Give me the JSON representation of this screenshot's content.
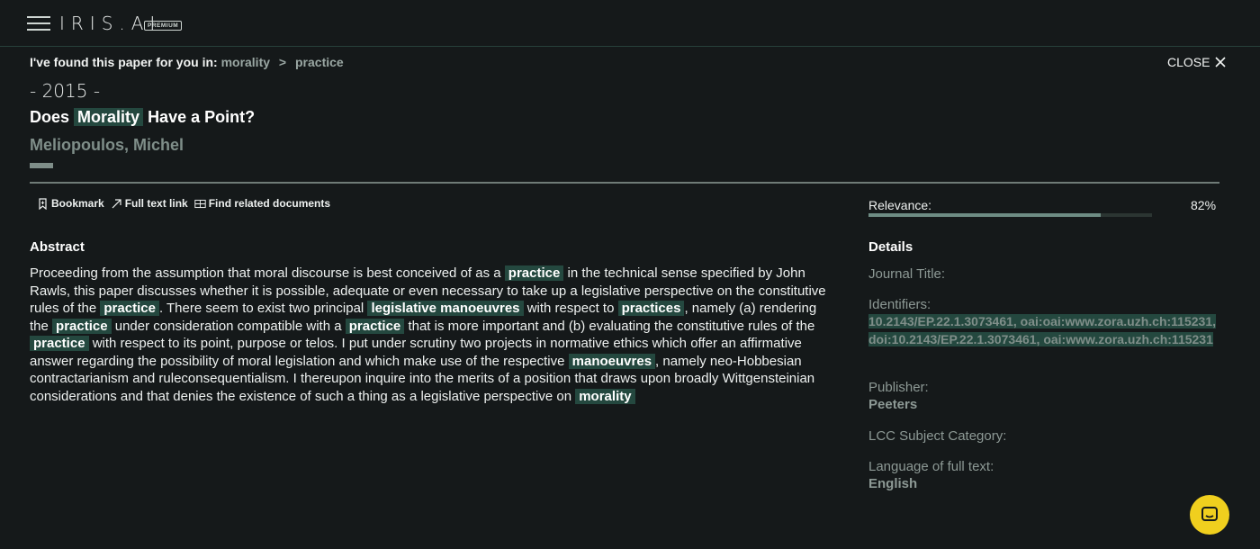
{
  "header": {
    "logo": "IRIS.AI",
    "badge": "PREMIUM"
  },
  "crumb": {
    "intro": "I've found this paper for you in:",
    "path": [
      "morality",
      "practice"
    ],
    "separator": ">"
  },
  "close_label": "CLOSE",
  "paper": {
    "year": "- 2015 -",
    "title_pre": "Does",
    "title_hl": "Morality",
    "title_post": "Have a Point?",
    "author": "Meliopoulos, Michel"
  },
  "actions": {
    "bookmark": "Bookmark",
    "full_text": "Full text link",
    "related": "Find related documents"
  },
  "relevance": {
    "label": "Relevance:",
    "value": "82%",
    "fraction": 0.82
  },
  "abstract": {
    "heading": "Abstract",
    "segments": [
      {
        "t": "Proceeding from the assumption that moral discourse is best conceived of as a ",
        "hl": false
      },
      {
        "t": "practice",
        "hl": true
      },
      {
        "t": " in the technical sense specified by John Rawls, this paper discusses whether it is possible, adequate or even necessary to take up a legislative perspective on the constitutive rules of the ",
        "hl": false
      },
      {
        "t": "practice",
        "hl": true
      },
      {
        "t": ". There seem to exist two principal ",
        "hl": false
      },
      {
        "t": "legislative manoeuvres",
        "hl": true
      },
      {
        "t": " with respect to ",
        "hl": false
      },
      {
        "t": "practices",
        "hl": true
      },
      {
        "t": ", namely (a) rendering the ",
        "hl": false
      },
      {
        "t": "practice",
        "hl": true
      },
      {
        "t": " under consideration compatible with a ",
        "hl": false
      },
      {
        "t": "practice",
        "hl": true
      },
      {
        "t": " that is more important and (b) evaluating the constitutive rules of the ",
        "hl": false
      },
      {
        "t": "practice",
        "hl": true
      },
      {
        "t": " with respect to its point, purpose or telos. I put under scrutiny two projects in normative ethics which offer an affirmative answer regarding the possibility of moral legislation and which make use of the respective ",
        "hl": false
      },
      {
        "t": "manoeuvres",
        "hl": true
      },
      {
        "t": ", namely neo-Hobbesian contractarianism and ruleconsequentialism. I thereupon inquire into the merits of a position that draws upon broadly Wittgensteinian considerations and that denies the existence of such a thing as a legislative perspective on ",
        "hl": false
      },
      {
        "t": "morality",
        "hl": true
      }
    ]
  },
  "details": {
    "heading": "Details",
    "journal_label": "Journal Title:",
    "identifiers_label": "Identifiers:",
    "identifiers_value": "10.2143/EP.22.1.3073461, oai:oai:www.zora.uzh.ch:115231, doi:10.2143/EP.22.1.3073461, oai:www.zora.uzh.ch:115231",
    "publisher_label": "Publisher:",
    "publisher_value": "Peeters",
    "lcc_label": "LCC Subject Category:",
    "language_label": "Language of full text:",
    "language_value": "English"
  },
  "icons": [
    "menu-icon",
    "close-icon",
    "bookmark-icon",
    "external-link-icon",
    "related-docs-icon",
    "chat-icon"
  ],
  "colors": {
    "background": "#15191a",
    "highlight": "#24483f",
    "chat_button": "#f0cf1e"
  }
}
